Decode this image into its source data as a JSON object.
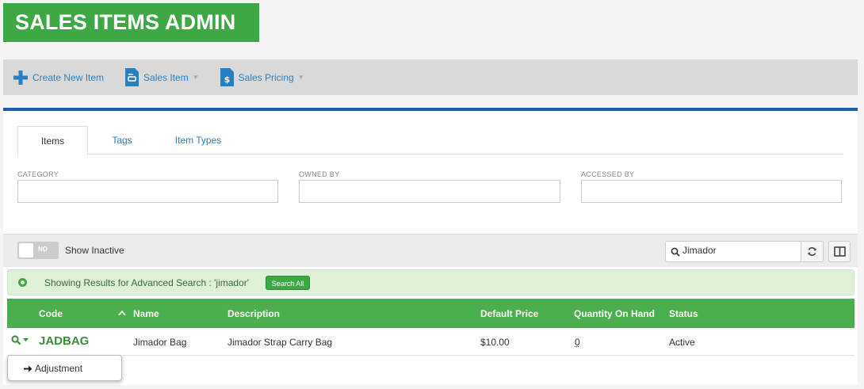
{
  "page_title": "SALES ITEMS ADMIN",
  "toolbar": {
    "create_label": "Create New Item",
    "sales_item_label": "Sales Item",
    "sales_pricing_label": "Sales Pricing"
  },
  "tabs": [
    {
      "label": "Items",
      "active": true
    },
    {
      "label": "Tags",
      "active": false
    },
    {
      "label": "Item Types",
      "active": false
    }
  ],
  "filters": {
    "category_label": "CATEGORY",
    "owned_by_label": "OWNED BY",
    "accessed_by_label": "ACCESSED BY"
  },
  "toggle": {
    "state_label": "NO",
    "label": "Show Inactive"
  },
  "search": {
    "value": "Jimador"
  },
  "results": {
    "message": "Showing Results for Advanced Search : 'jimador'",
    "search_all_label": "Search All"
  },
  "table": {
    "columns": [
      "Code",
      "Name",
      "Description",
      "Default Price",
      "Quantity On Hand",
      "Status"
    ],
    "rows": [
      {
        "code": "JADBAG",
        "name": "Jimador Bag",
        "description": "Jimador Strap Carry Bag",
        "default_price": "$10.00",
        "quantity_on_hand": "0",
        "status": "Active"
      }
    ]
  },
  "row_menu": {
    "items": [
      "Adjustment"
    ]
  },
  "colors": {
    "brand_green": "#3fa846",
    "header_green": "#4caf4f",
    "link_blue": "#2a7fc1",
    "panel_border_blue": "#1d5fa0"
  }
}
